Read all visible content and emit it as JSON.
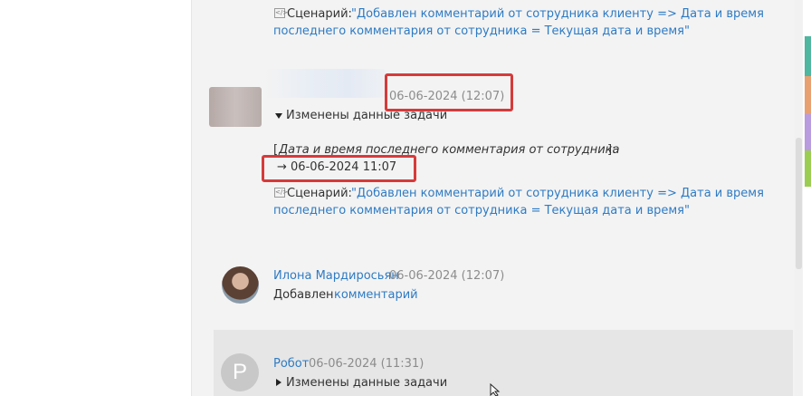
{
  "entries": [
    {
      "script_label": "Сценарий:",
      "script_line1": "\"Добавлен комментарий от сотрудника клиенту => Дата и время",
      "script_line2": "последнего комментария от сотрудника = Текущая дата и время\""
    },
    {
      "timestamp": "06-06-2024 (12:07)",
      "toggle_label": "Изменены данные задачи",
      "field_name": "Дата и время последнего комментария от сотрудника",
      "new_value": "→ 06-06-2024 11:07",
      "script_label": "Сценарий:",
      "script_line1": "\"Добавлен комментарий от сотрудника клиенту => Дата и время",
      "script_line2": "последнего комментария от сотрудника = Текущая дата и время\""
    },
    {
      "author": "Илона Мардиросьян",
      "timestamp": "06-06-2024 (12:07)",
      "action": "Добавлен",
      "action_link": "комментарий"
    },
    {
      "avatar_letter": "Р",
      "author": "Робот",
      "timestamp": "06-06-2024 (11:31)",
      "toggle_label": "Изменены данные задачи"
    }
  ],
  "colors": {
    "link": "#2e7bc4",
    "highlight": "#d63a3a",
    "strips": [
      "#ffffff",
      "#4fb6a0",
      "#e8a070",
      "#b99be0",
      "#9acd52",
      "#ffffff"
    ]
  }
}
